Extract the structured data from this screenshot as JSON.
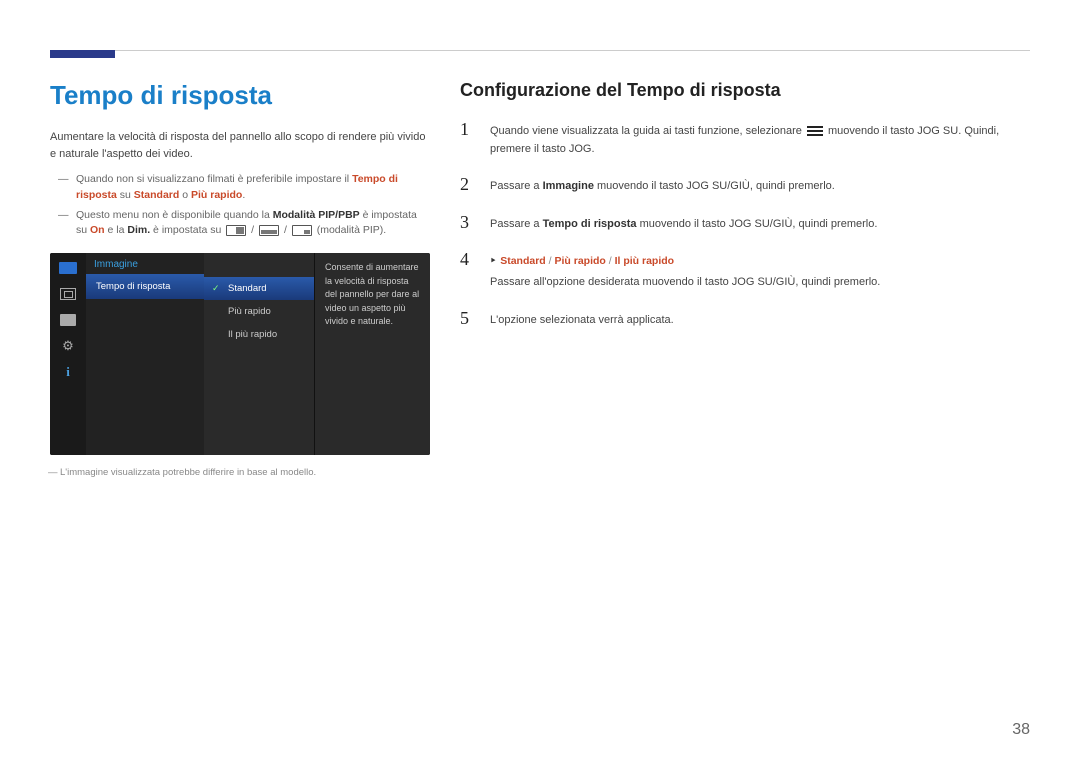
{
  "page_number": "38",
  "left": {
    "title": "Tempo di risposta",
    "intro": "Aumentare la velocità di risposta del pannello allo scopo di rendere più vivido e naturale l'aspetto dei video.",
    "note1_pre": "Quando non si visualizzano filmati è preferibile impostare il ",
    "note1_hl": "Tempo di risposta",
    "note1_mid": " su ",
    "note1_std": "Standard",
    "note1_or": " o ",
    "note1_fast": "Più rapido",
    "note1_end": ".",
    "note2_pre": "Questo menu non è disponibile quando la ",
    "note2_mode": "Modalità PIP/PBP",
    "note2_mid": " è impostata su ",
    "note2_on": "On",
    "note2_and": " e la ",
    "note2_dim": "Dim.",
    "note2_set": " è impostata su ",
    "note2_suffix": " (modalità PIP).",
    "footnote": "L'immagine visualizzata potrebbe differire in base al modello."
  },
  "osd": {
    "category": "Immagine",
    "active_item": "Tempo di risposta",
    "options": {
      "opt1": "Standard",
      "opt2": "Più rapido",
      "opt3": "Il più rapido"
    },
    "description": "Consente di aumentare la velocità di risposta del pannello per dare al video un aspetto più vivido e naturale."
  },
  "right": {
    "title": "Configurazione del Tempo di risposta",
    "step1_a": "Quando viene visualizzata la guida ai tasti funzione, selezionare ",
    "step1_b": " muovendo il tasto JOG SU. Quindi, premere il tasto JOG.",
    "step2_a": "Passare a ",
    "step2_hl": "Immagine",
    "step2_b": " muovendo il tasto JOG SU/GIÙ, quindi premerlo.",
    "step3_a": "Passare a ",
    "step3_hl": "Tempo di risposta",
    "step3_b": " muovendo il tasto JOG SU/GIÙ, quindi premerlo.",
    "options": {
      "opt1": "Standard",
      "opt2": "Più rapido",
      "opt3": "Il più rapido"
    },
    "step4": "Passare all'opzione desiderata muovendo il tasto JOG SU/GIÙ, quindi premerlo.",
    "step5": "L'opzione selezionata verrà applicata."
  }
}
